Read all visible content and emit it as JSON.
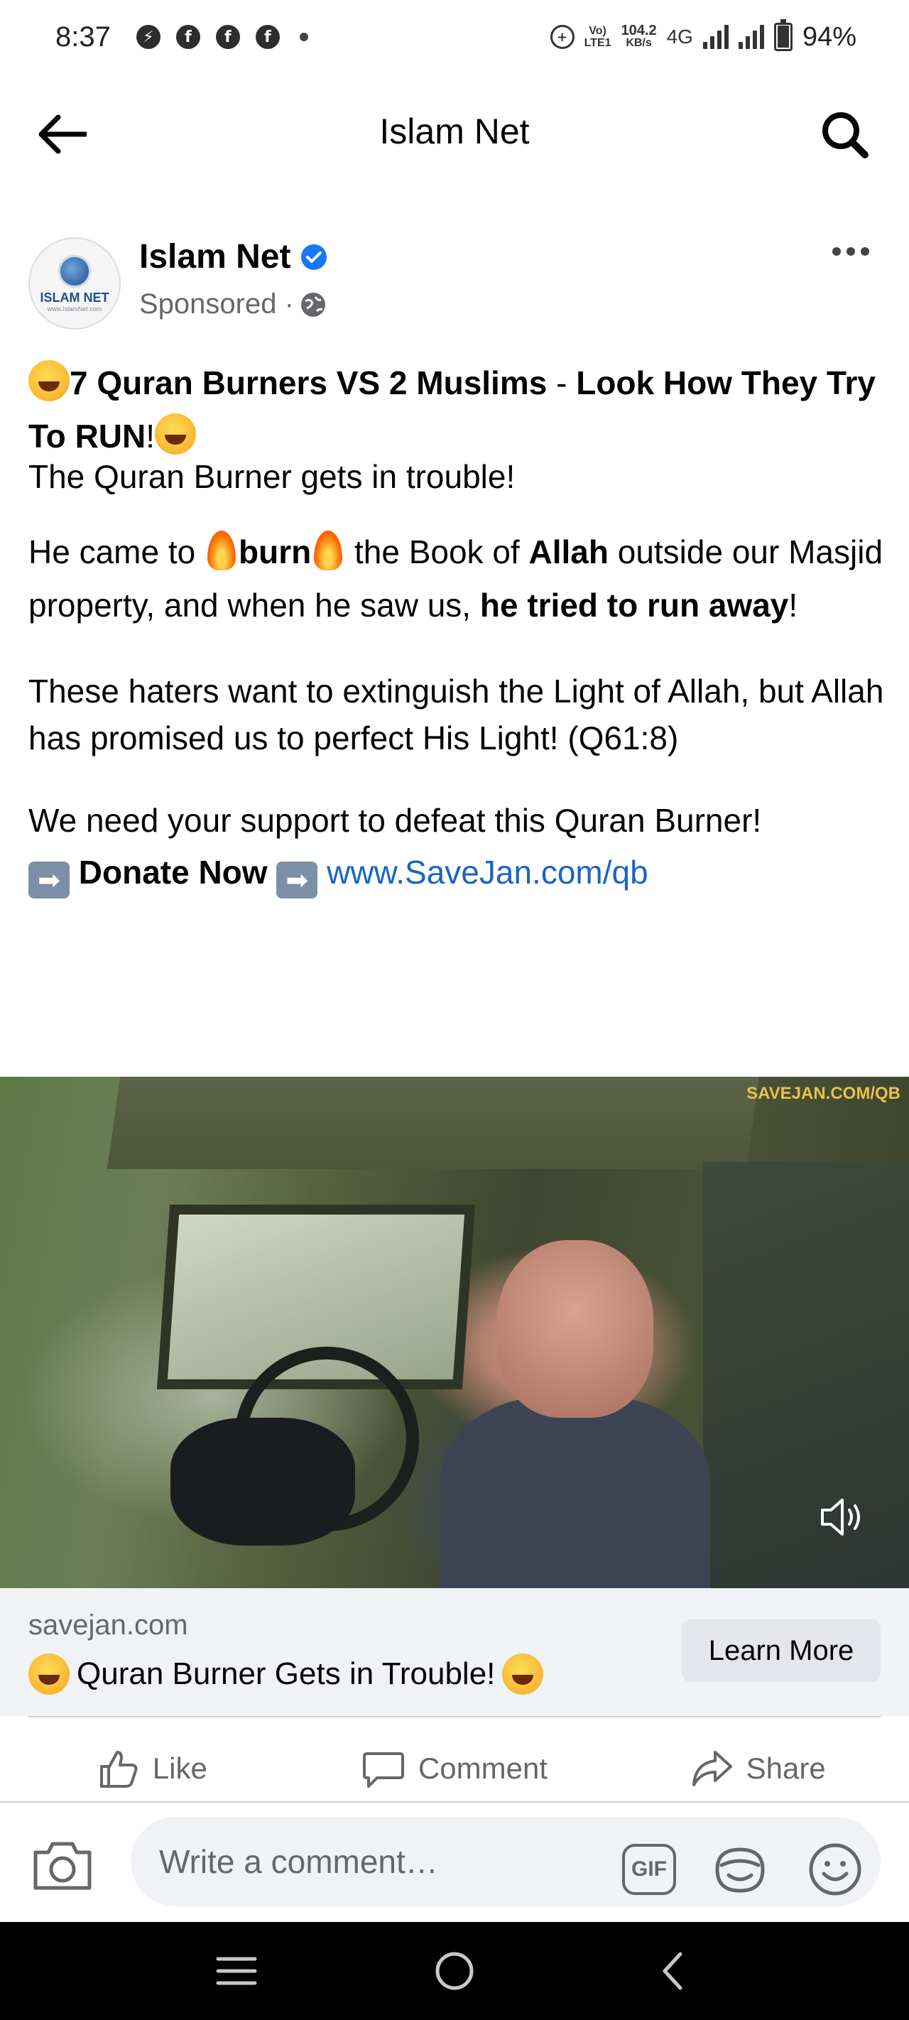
{
  "status_bar": {
    "time": "8:37",
    "data_rate_value": "104.2",
    "data_rate_unit": "KB/s",
    "volte_top": "Vo)",
    "volte_bottom": "LTE1",
    "network": "4G",
    "battery": "94%"
  },
  "header": {
    "title": "Islam Net"
  },
  "post": {
    "page_name": "Islam Net",
    "sponsored": "Sponsored ·",
    "avatar_text": "ISLAM NET",
    "avatar_sub": "www.IslamNet.com",
    "title_part1": "7 Quran Burners VS 2 Muslims",
    "title_sep": " - ",
    "title_part2": "Look How They Try To RUN",
    "title_excl": "!",
    "line1": "The Quran Burner gets in trouble!",
    "p2_a": "He came to ",
    "p2_burn": "burn",
    "p2_b": " the Book of ",
    "p2_allah": "Allah",
    "p2_c": " outside our Masjid property, and when he saw us, ",
    "p2_d": "he tried to run away",
    "p2_e": "!",
    "p3": "These haters want to extinguish the Light of Allah, but Allah has promised us to perfect His Light! (Q61:8)",
    "p4": "We need your support to defeat this Quran Burner!",
    "donate": "Donate Now",
    "donate_link": "www.SaveJan.com/qb",
    "arrow_glyph": "➡"
  },
  "video": {
    "watermark": "SAVEJAN.COM/QB"
  },
  "link_preview": {
    "domain": "savejan.com",
    "title": "Quran Burner Gets in Trouble!",
    "cta": "Learn More"
  },
  "actions": {
    "like": "Like",
    "comment": "Comment",
    "share": "Share"
  },
  "comment_bar": {
    "placeholder": "Write a comment…",
    "gif": "GIF"
  },
  "colors": {
    "accent_blue": "#1877f2",
    "link_blue": "#1a64c6",
    "secondary_text": "#65676b"
  }
}
